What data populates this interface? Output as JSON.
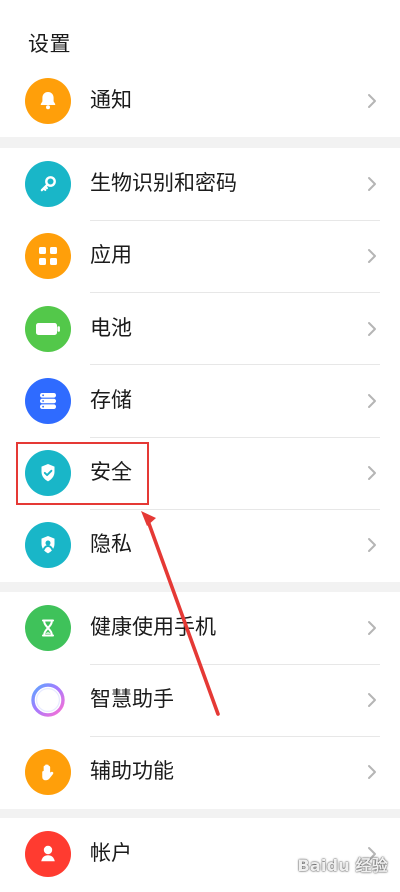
{
  "header": {
    "title": "设置"
  },
  "items": [
    {
      "label": "通知",
      "icon": "bell-icon",
      "color": "#ff9f0a"
    },
    {
      "label": "生物识别和密码",
      "icon": "key-icon",
      "color": "#19b6c8"
    },
    {
      "label": "应用",
      "icon": "apps-grid-icon",
      "color": "#ff9f0a"
    },
    {
      "label": "电池",
      "icon": "battery-icon",
      "color": "#53c84a"
    },
    {
      "label": "存储",
      "icon": "storage-icon",
      "color": "#2f6bff"
    },
    {
      "label": "安全",
      "icon": "shield-check-icon",
      "color": "#19b6c8"
    },
    {
      "label": "隐私",
      "icon": "privacy-icon",
      "color": "#19b6c8"
    },
    {
      "label": "健康使用手机",
      "icon": "hourglass-icon",
      "color": "#3fc25a"
    },
    {
      "label": "智慧助手",
      "icon": "assistant-orb-icon",
      "color": "#ffffff"
    },
    {
      "label": "辅助功能",
      "icon": "hand-icon",
      "color": "#ff9f0a"
    },
    {
      "label": "帐户",
      "icon": "account-icon",
      "color": "#ff3b30"
    }
  ],
  "watermark": {
    "text": "Baidu 经验"
  },
  "annotation": {
    "highlight_color": "#e53935",
    "arrow_color": "#e53935"
  }
}
